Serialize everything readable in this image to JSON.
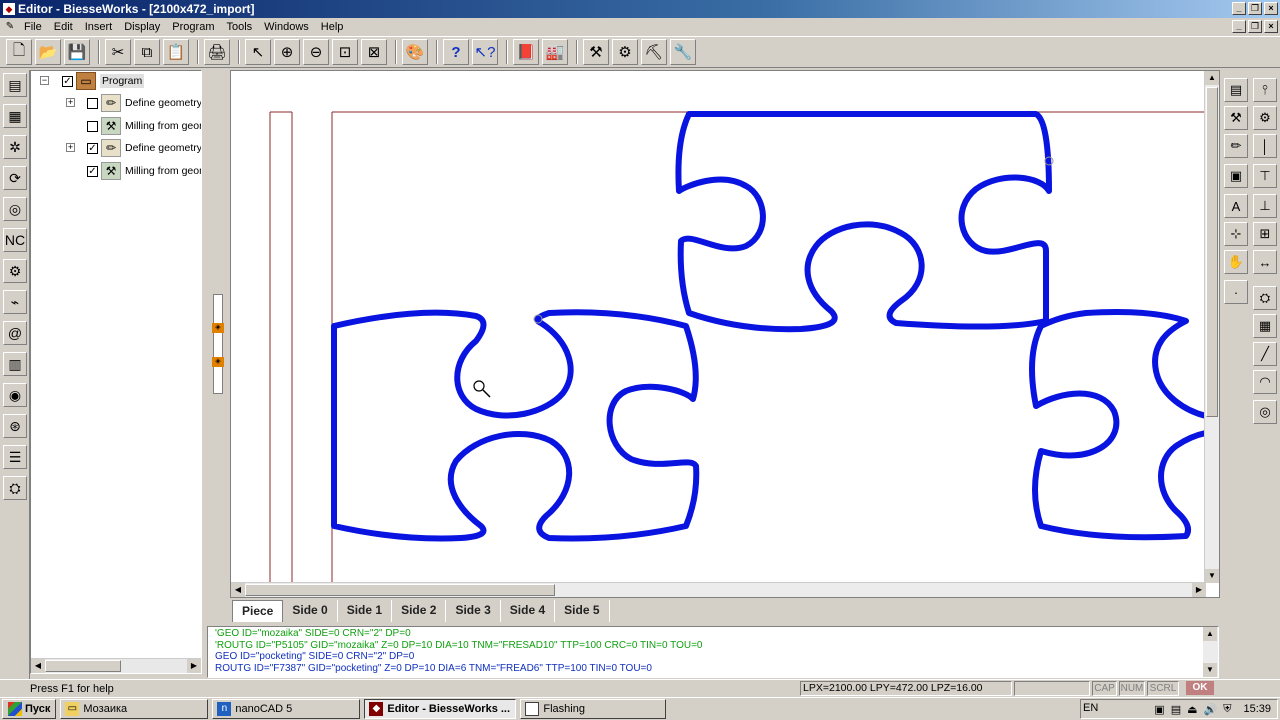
{
  "window": {
    "title": "Editor - BiesseWorks - [2100x472_import]"
  },
  "menu": [
    "File",
    "Edit",
    "Insert",
    "Display",
    "Program",
    "Tools",
    "Windows",
    "Help"
  ],
  "toolbar_icons": [
    "new-file-icon",
    "open-folder-icon",
    "save-icon",
    "cut-icon",
    "copy-icon",
    "paste-icon",
    "print-icon",
    "pointer-icon",
    "zoom-in-icon",
    "zoom-out-icon",
    "zoom-window-icon",
    "zoom-all-icon",
    "color-palette-icon",
    "help-icon",
    "context-help-icon",
    "book-icon",
    "machine-icon",
    "tool-1-icon",
    "tool-2-icon",
    "tool-3-icon",
    "tool-4-icon"
  ],
  "tree": {
    "root": "Program",
    "items": [
      {
        "label": "Define geometry",
        "checked": false,
        "expandable": true
      },
      {
        "label": "Milling from geon",
        "checked": false,
        "expandable": false
      },
      {
        "label": "Define geometry",
        "checked": true,
        "expandable": true
      },
      {
        "label": "Milling from geon",
        "checked": true,
        "expandable": false
      }
    ]
  },
  "tabs": [
    "Piece",
    "Side 0",
    "Side 1",
    "Side 2",
    "Side 3",
    "Side 4",
    "Side 5"
  ],
  "active_tab": "Piece",
  "code_lines": [
    {
      "text": "'GEO ID=\"mozaika\" SIDE=0 CRN=\"2\" DP=0",
      "color": "#10a010"
    },
    {
      "text": "'ROUTG ID=\"P5105\" GID=\"mozaika\" Z=0 DP=10 DIA=10 TNM=\"FRESAD10\" TTP=100 CRC=0 TIN=0 TOU=0",
      "color": "#10a010"
    },
    {
      "text": "GEO ID=\"pocketing\" SIDE=0 CRN=\"2\" DP=0",
      "color": "#1030c0"
    },
    {
      "text": "ROUTG ID=\"F7387\" GID=\"pocketing\" Z=0 DP=10 DIA=6 TNM=\"FREAD6\" TTP=100 TIN=0 TOU=0",
      "color": "#1030c0"
    }
  ],
  "status": {
    "help": "Press F1 for help",
    "coords": "LPX=2100.00  LPY=472.00  LPZ=16.00",
    "cap": "CAP",
    "num": "NUM",
    "scrl": "SCRL",
    "ok": "OK"
  },
  "taskbar": {
    "start": "Пуск",
    "tasks": [
      {
        "label": "Мозаика",
        "active": false
      },
      {
        "label": "nanoCAD 5",
        "active": false
      },
      {
        "label": "Editor - BiesseWorks ...",
        "active": true
      },
      {
        "label": "Flashing",
        "active": false
      }
    ],
    "lang": "EN",
    "clock": "15:39"
  },
  "colors": {
    "toolpath": "#0a14e0",
    "outline": "#8b2a2a"
  }
}
